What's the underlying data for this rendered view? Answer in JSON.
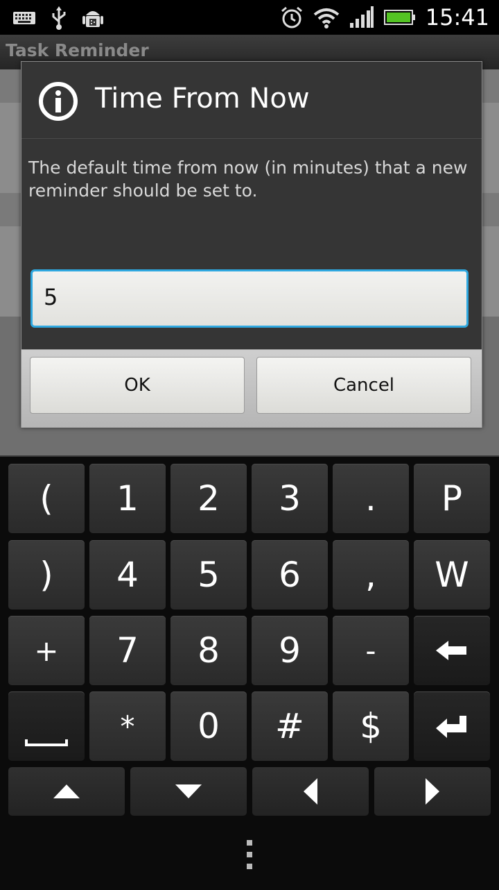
{
  "status_bar": {
    "time": "15:41",
    "left_icons": [
      "keyboard-icon",
      "usb-icon",
      "android-debug-icon"
    ],
    "right_icons": [
      "alarm-clock-icon",
      "wifi-icon",
      "signal-icon",
      "battery-icon"
    ]
  },
  "app": {
    "title": "Task Reminder"
  },
  "dialog": {
    "title": "Time From Now",
    "icon": "info-icon",
    "message": "The default time from now (in minutes) that a new reminder should be set to.",
    "input_value": "5",
    "ok_label": "OK",
    "cancel_label": "Cancel",
    "accent_color": "#2fa8e0"
  },
  "keyboard": {
    "rows": [
      [
        "(",
        "1",
        "2",
        "3",
        ".",
        "P"
      ],
      [
        ")",
        "4",
        "5",
        "6",
        ",",
        "W"
      ],
      [
        "+",
        "7",
        "8",
        "9",
        "-",
        "backspace-icon"
      ],
      [
        "space-icon",
        "*",
        "0",
        "#",
        "$",
        "enter-icon"
      ]
    ],
    "arrow_keys": [
      "arrow-up-icon",
      "arrow-down-icon",
      "arrow-left-icon",
      "arrow-right-icon"
    ]
  }
}
